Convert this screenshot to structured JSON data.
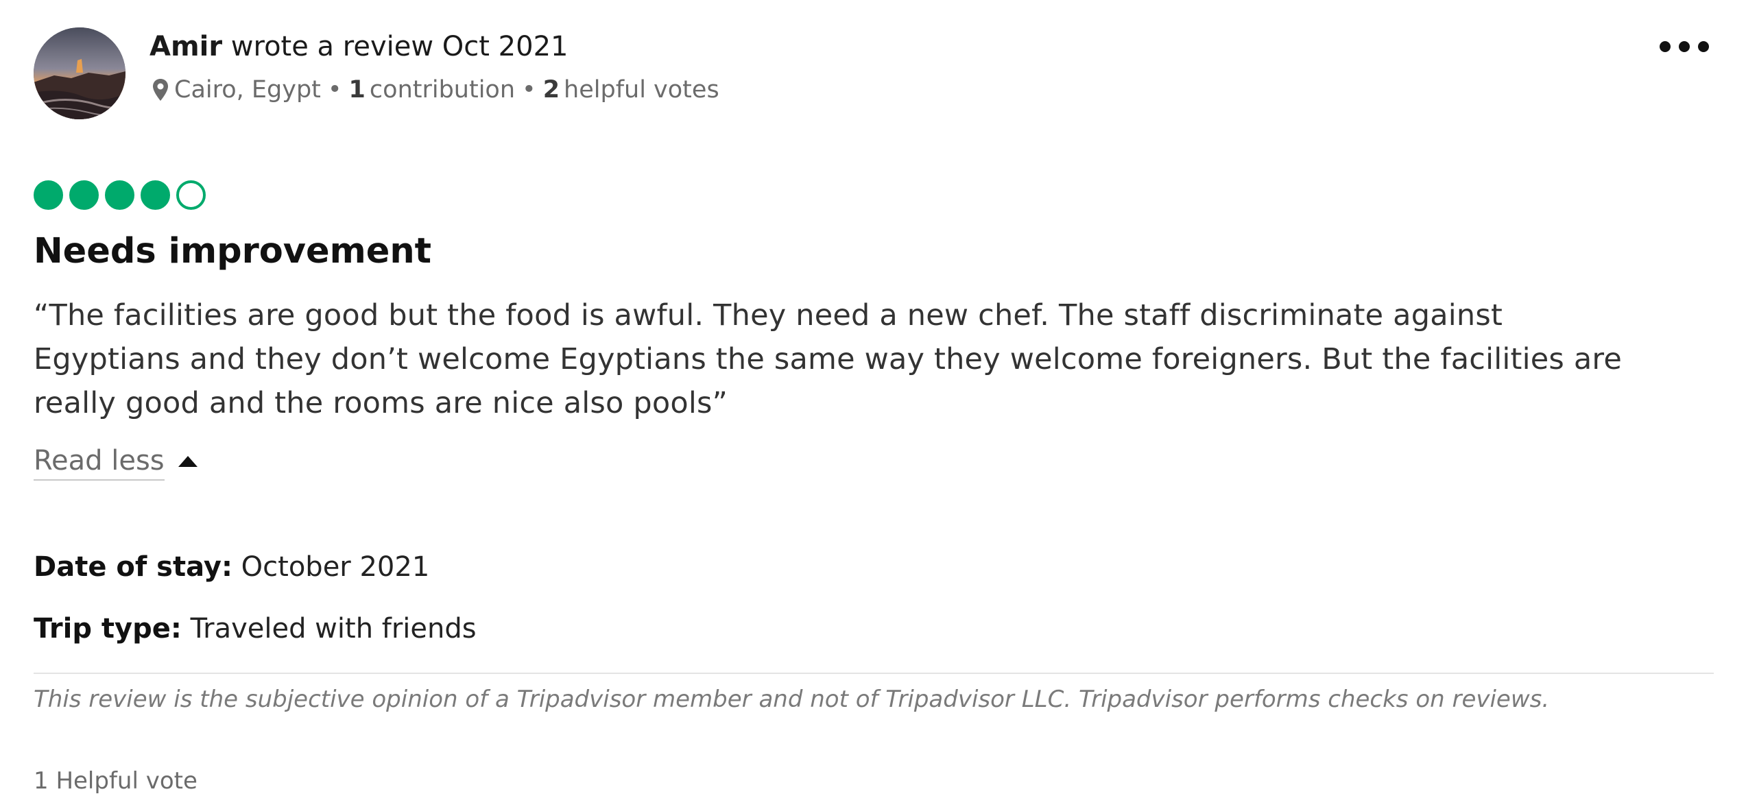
{
  "review": {
    "author": {
      "name": "Amir",
      "action": "wrote a review",
      "date": "Oct 2021",
      "location": "Cairo, Egypt",
      "contributions_count": "1",
      "contributions_label": "contribution",
      "helpful_votes_count": "2",
      "helpful_votes_label": "helpful votes",
      "avatar_icon": "avatar-photo"
    },
    "menu_icon": "more-options-icon",
    "rating": {
      "value": 4,
      "max": 5,
      "color": "#00aa6c"
    },
    "title": "Needs improvement",
    "body_lines": [
      "“The facilities are good but the food is awful. They need a new chef. The staff discriminate against",
      "Egyptians and they don’t welcome Egyptians the same way they welcome foreigners. But the facilities are",
      "really good and the rooms are nice also pools”"
    ],
    "read_less_label": "Read less",
    "date_of_stay": {
      "label": "Date of stay:",
      "value": "October 2021"
    },
    "trip_type": {
      "label": "Trip type:",
      "value": "Traveled with friends"
    },
    "disclaimer": "This review is the subjective opinion of a Tripadvisor member and not of Tripadvisor LLC. Tripadvisor performs checks on reviews.",
    "helpful_vote_text": "1 Helpful vote"
  }
}
